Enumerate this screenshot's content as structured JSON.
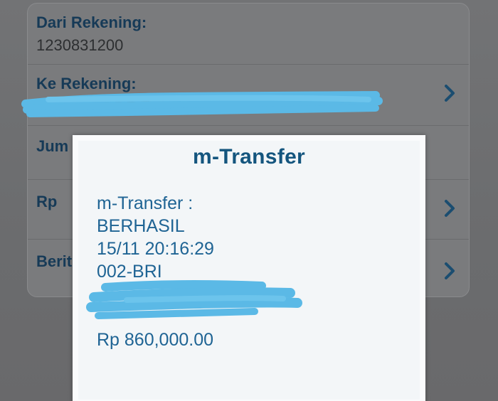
{
  "form": {
    "from_account": {
      "label": "Dari Rekening:",
      "value": "1230831200"
    },
    "to_account": {
      "label": "Ke Rekening:",
      "value_redacted": true,
      "chevron_icon": "chevron-right-icon"
    },
    "amount_label_partial": "Jum",
    "currency_label": "Rp",
    "news_label_partial": "Berit"
  },
  "dialog": {
    "title": "m-Transfer",
    "status_header": "m-Transfer :",
    "status": "BERHASIL",
    "datetime": "15/11 20:16:29",
    "bank": "002-BRI",
    "account_redacted": true,
    "amount": "Rp 860,000.00"
  },
  "colors": {
    "label_blue": "#163a57",
    "dialog_title_blue": "#14557e",
    "dialog_text_blue": "#1f6494",
    "redaction_cyan": "#5bb9e6",
    "chevron_blue": "#1b4d70"
  }
}
